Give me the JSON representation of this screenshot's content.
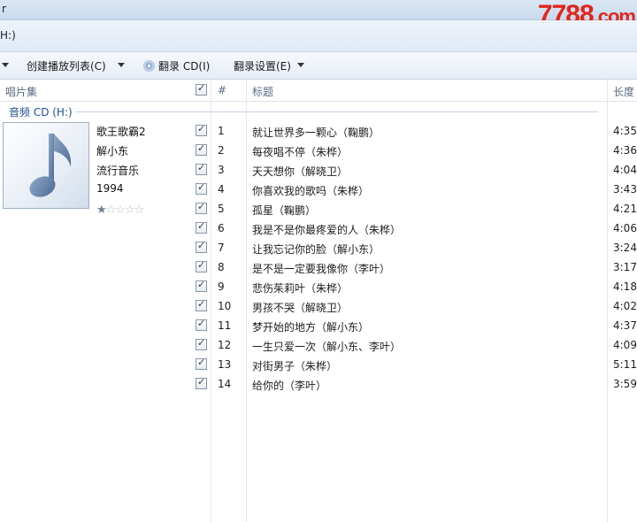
{
  "window": {
    "title": "r",
    "address": "H:)"
  },
  "watermark": {
    "main": "7788",
    "suffix": ".com"
  },
  "toolbar": {
    "create_playlist": "创建播放列表(C)",
    "rip_cd": "翻录 CD(I)",
    "rip_settings": "翻录设置(E)"
  },
  "columns": {
    "album": "唱片集",
    "number": "#",
    "title": "标题",
    "length": "长度"
  },
  "group_label": "音频 CD (H:)",
  "album": {
    "name": "歌王歌霸2",
    "artist": "解小东",
    "genre": "流行音乐",
    "year": "1994",
    "rating_stars": 1,
    "rating_max": 5
  },
  "tracks": [
    {
      "num": "1",
      "title": "就让世界多一颗心（鞠鹏）",
      "length": "4:35"
    },
    {
      "num": "2",
      "title": "每夜唱不停（朱桦）",
      "length": "4:36"
    },
    {
      "num": "3",
      "title": "天天想你（解晓卫）",
      "length": "4:04"
    },
    {
      "num": "4",
      "title": "你喜欢我的歌吗（朱桦）",
      "length": "3:43"
    },
    {
      "num": "5",
      "title": "孤星（鞠鹏）",
      "length": "4:21"
    },
    {
      "num": "6",
      "title": "我是不是你最疼爱的人（朱桦）",
      "length": "4:06"
    },
    {
      "num": "7",
      "title": "让我忘记你的脸（解小东）",
      "length": "3:24"
    },
    {
      "num": "8",
      "title": "是不是一定要我像你（李叶）",
      "length": "3:17"
    },
    {
      "num": "9",
      "title": "悲伤茱莉叶（朱桦）",
      "length": "4:18"
    },
    {
      "num": "10",
      "title": "男孩不哭（解晓卫）",
      "length": "4:02"
    },
    {
      "num": "11",
      "title": "梦开始的地方（解小东）",
      "length": "4:37"
    },
    {
      "num": "12",
      "title": "一生只爱一次（解小东、李叶）",
      "length": "4:09"
    },
    {
      "num": "13",
      "title": "对街男子（朱桦）",
      "length": "5:11"
    },
    {
      "num": "14",
      "title": "给你的（李叶）",
      "length": "3:59"
    }
  ]
}
